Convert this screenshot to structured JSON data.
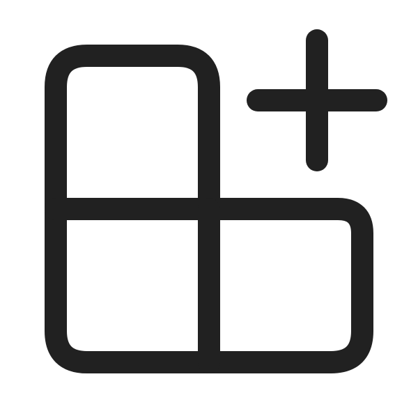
{
  "icon": {
    "name": "apps-add-icon",
    "stroke_color": "#212121",
    "background_color": "#ffffff"
  }
}
